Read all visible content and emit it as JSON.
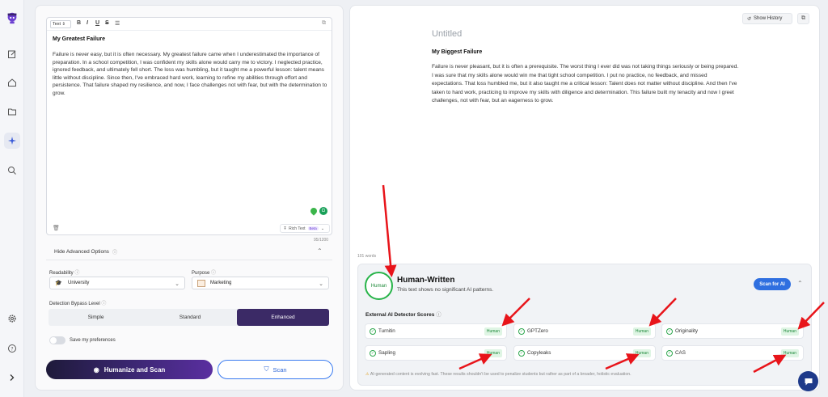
{
  "editor": {
    "text_style": "Text",
    "title": "My Greatest Failure",
    "body": "Failure is never easy, but it is often necessary. My greatest failure came when I underestimated the importance of preparation. In a school competition, I was confident my skills alone would carry me to victory. I neglected practice, ignored feedback, and ultimately fell short. The loss was humbling, but it taught me a powerful lesson: talent means little without discipline. Since then, I've embraced hard work, learning to refine my abilities through effort and persistence. That failure shaped my resilience, and now, I face challenges not with fear, but with the determination to grow.",
    "rich_text_label": "Rich Text",
    "beta_label": "Beta",
    "char_count": "95/1200"
  },
  "advanced": {
    "toggle_label": "Hide Advanced Options",
    "readability_label": "Readability",
    "readability_value": "University",
    "purpose_label": "Purpose",
    "purpose_value": "Marketing",
    "bypass_label": "Detection Bypass Level",
    "levels": [
      "Simple",
      "Standard",
      "Enhanced"
    ],
    "save_label": "Save my preferences"
  },
  "actions": {
    "humanize_label": "Humanize and Scan",
    "scan_label": "Scan"
  },
  "output": {
    "show_history_label": "Show History",
    "doc_title": "Untitled",
    "heading": "My Biggest Failure",
    "body": "Failure is never  pleasant, but it is often a prerequisite. The worst thing I ever did was not taking things seriously  or being prepared. I was sure that  my skills alone would win me that tight school competition. I put no practice, no feedback,  and missed expectations. That loss humbled me, but it  also taught me a critical lesson: Talent does not matter without discipline. And then I've taken to hard work, practicing to improve  my skills with diligence and determination. This failure built my tenacity and now I  greet challenges, not with fear, but an eagerness to grow.",
    "word_count": "101 words"
  },
  "result": {
    "badge": "Human",
    "title": "Human-Written",
    "description": "This text shows no significant AI patterns.",
    "scan_ai_label": "Scan for AI",
    "detectors_title": "External AI Detector Scores",
    "detectors": [
      {
        "name": "Turnitin",
        "score": "Human"
      },
      {
        "name": "GPTZero",
        "score": "Human"
      },
      {
        "name": "Originality",
        "score": "Human"
      },
      {
        "name": "Sapling",
        "score": "Human"
      },
      {
        "name": "Copyleaks",
        "score": "Human"
      },
      {
        "name": "CAS",
        "score": "Human"
      }
    ],
    "disclaimer": "AI-generated content is evolving fast. These results shouldn't be used to penalize students but rather as part of a broader, holistic evaluation."
  },
  "colors": {
    "accent": "#2f6fe0",
    "human_green": "#27b449",
    "enhanced_bg": "#3b2a66",
    "arrow_red": "#e8141a"
  }
}
